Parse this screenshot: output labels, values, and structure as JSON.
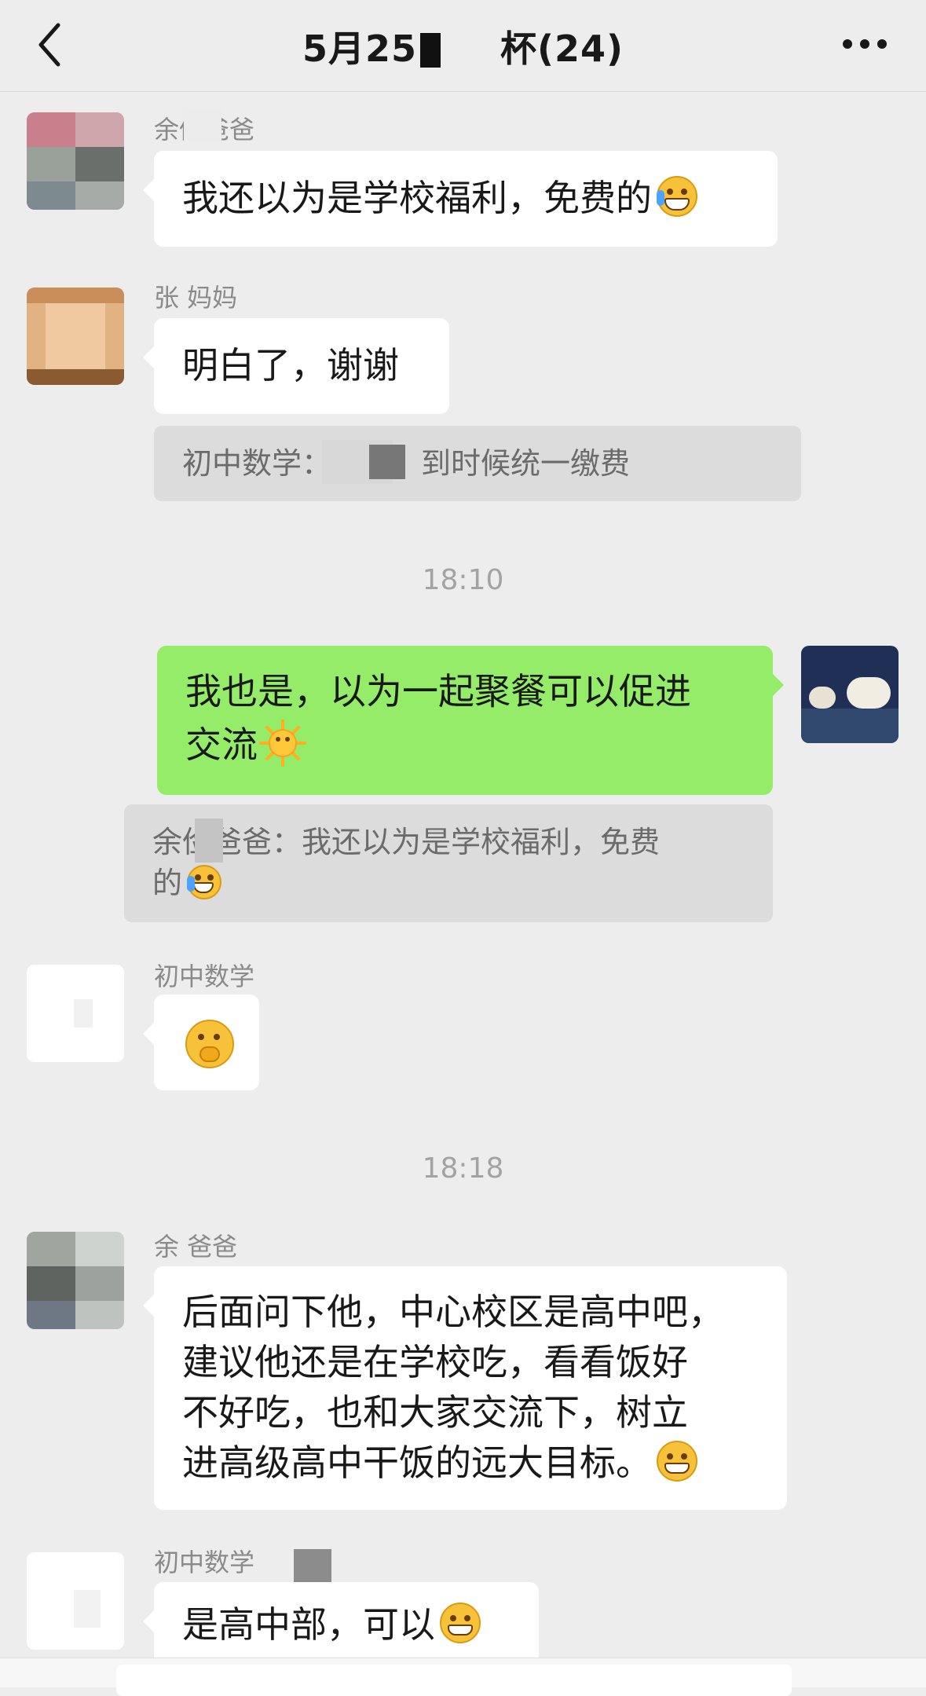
{
  "header": {
    "title_prefix": "5月25",
    "title_suffix": "杯(24)"
  },
  "messages": [
    {
      "sender": "余俭爸爸",
      "text": "我还以为是学校福利，免费的"
    },
    {
      "sender": "张  妈妈",
      "text": "明白了，谢谢"
    },
    {
      "quote": "初中数学：不用，到时候统一缴费"
    },
    {
      "time": "18:10"
    },
    {
      "self": true,
      "text_line1": "我也是，以为一起聚餐可以促进",
      "text_line2": "交流"
    },
    {
      "quote_line1": "余俭爸爸：我还以为是学校福利，免费",
      "quote_line2": "的"
    },
    {
      "sender": "初中数学"
    },
    {
      "time": "18:18"
    },
    {
      "sender": "余  爸爸",
      "lines": [
        "后面问下他，中心校区是高中吧，",
        "建议他还是在学校吃，看看饭好",
        "不好吃，也和大家交流下，树立",
        "进高级高中干饭的远大目标。"
      ]
    },
    {
      "sender": "初中数学",
      "text": "是高中部，可以"
    }
  ],
  "icons": {
    "back": "chevron-left-icon",
    "more": "more-dots-icon",
    "emoji_laugh_cry": "laugh-cry-emoji",
    "emoji_sun": "sun-emoji",
    "emoji_think": "thinking-emoji",
    "emoji_grin": "grin-emoji"
  },
  "colors": {
    "self_bubble": "#95ec69",
    "other_bubble": "#ffffff",
    "background": "#ededed"
  }
}
